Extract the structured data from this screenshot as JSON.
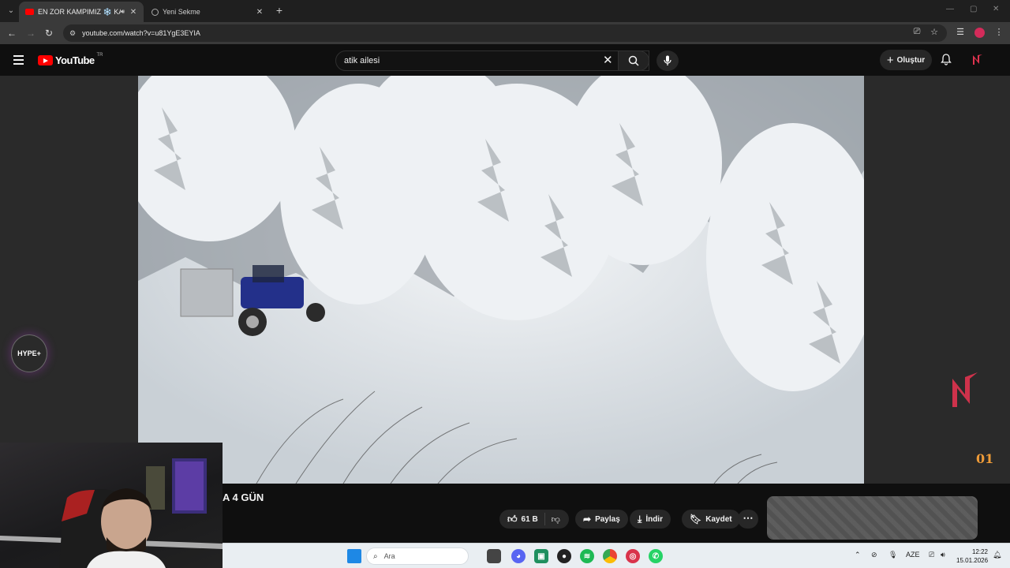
{
  "browser": {
    "tabs": [
      {
        "title": "EN ZOR KAMPIMIZ ❄️ KAR",
        "active": true
      },
      {
        "title": "Yeni Sekme",
        "active": false
      }
    ],
    "url": "youtube.com/watch?v=u81YgE3EYIA"
  },
  "youtube": {
    "logo_text": "YouTube",
    "region": "TR",
    "search_query": "atik ailesi",
    "create_label": "Oluştur"
  },
  "video": {
    "title_visible": "A 4 GÜN",
    "likes": "61 B",
    "share_label": "Paylaş",
    "download_label": "İndir",
    "save_label": "Kaydet"
  },
  "overlay": {
    "hype_label": "HYPE+",
    "badge_text": "01"
  },
  "taskbar": {
    "search_placeholder": "Ara",
    "language": "AZE",
    "time": "12:22",
    "date": "15.01.2026"
  },
  "colors": {
    "yt_red": "#ff0000",
    "background": "#0f0f0f",
    "accent_pink": "#d42b5a"
  }
}
